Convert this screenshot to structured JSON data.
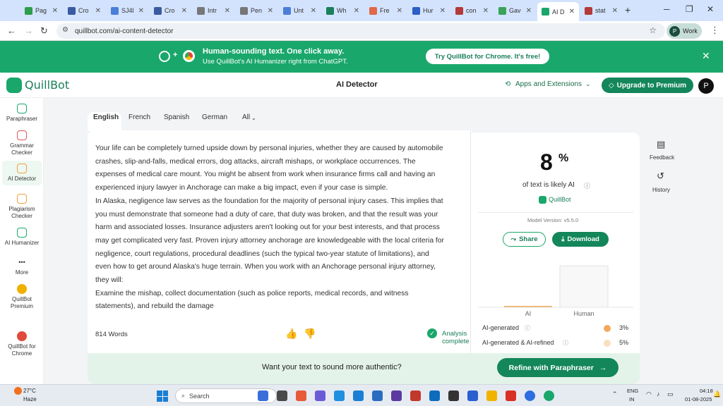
{
  "browser": {
    "tabs": [
      {
        "label": "Pag",
        "color": "#2e9e4d"
      },
      {
        "label": "Cro",
        "color": "#3a5ba0"
      },
      {
        "label": "SJ4l",
        "color": "#4a7fd9"
      },
      {
        "label": "Cro",
        "color": "#3a5ba0"
      },
      {
        "label": "Intr",
        "color": "#777777"
      },
      {
        "label": "Pen",
        "color": "#777777"
      },
      {
        "label": "Unt",
        "color": "#4a7fd9"
      },
      {
        "label": "Wh",
        "color": "#1a7f5a"
      },
      {
        "label": "Fre",
        "color": "#e06848"
      },
      {
        "label": "Hur",
        "color": "#2d5fc4"
      },
      {
        "label": "con",
        "color": "#b33a3a"
      },
      {
        "label": "Gav",
        "color": "#3aa35a"
      },
      {
        "label": "AI D",
        "color": "#1aa76b"
      },
      {
        "label": "stat",
        "color": "#b33a3a"
      }
    ],
    "new_tab": "+",
    "url": "quillbot.com/ai-content-detector",
    "profile_label": "Work",
    "profile_initial": "P"
  },
  "banner": {
    "title": "Human-sounding text. One click away.",
    "subtitle": "Use QuillBot's AI Humanizer right from ChatGPT.",
    "cta": "Try QuillBot for Chrome. It's free!",
    "plus": "+"
  },
  "header": {
    "logo_text": "QuillBot",
    "page_title": "AI Detector",
    "apps_label": "Apps and Extensions",
    "upgrade_label": "Upgrade to Premium",
    "avatar_initial": "P"
  },
  "sidebar": {
    "items": [
      {
        "label": "Paraphraser",
        "color": "#1aa76b"
      },
      {
        "label": "Grammar Checker",
        "color": "#e05555"
      },
      {
        "label": "AI Detector",
        "color": "#f0a040"
      },
      {
        "label": "Plagiarism Checker",
        "color": "#f0a040"
      },
      {
        "label": "AI Humanizer",
        "color": "#1aa76b"
      },
      {
        "label": "More",
        "color": "#333333"
      },
      {
        "label": "QuillBot Premium",
        "color": "#f0b000"
      },
      {
        "label": "QuillBot for Chrome",
        "color": "#e04a3a"
      }
    ]
  },
  "editor": {
    "languages": [
      "English",
      "French",
      "Spanish",
      "German",
      "All"
    ],
    "paragraphs": [
      "Your life can be completely turned upside down by personal injuries, whether they are caused by automobile crashes, slip-and-falls, medical errors, dog attacks, aircraft mishaps, or workplace occurrences. The expenses of medical care mount. You might be absent from work when insurance firms call and having an experienced injury lawyer in Anchorage can make a big impact, even if your case is simple.",
      "In Alaska, negligence law serves as the foundation for the majority of personal injury cases. This implies that you must demonstrate that someone had a duty of care, that duty was broken, and that the result was your harm and associated losses. Insurance adjusters aren't looking out for your best interests, and that process may get complicated very fast. Proven injury attorney anchorage are knowledgeable with the local criteria for negligence, court regulations, procedural deadlines (such the typical two-year statute of limitations), and even how to get around Alaska's huge terrain. When you work with an Anchorage personal injury attorney, they will:",
      "Examine the mishap, collect documentation (such as police reports, medical records, and witness statements), and rebuild the damage"
    ],
    "word_count": "814 Words",
    "status": "Analysis complete"
  },
  "results": {
    "percent": "8",
    "percent_sign": "%",
    "caption": "of text is likely AI",
    "brand": "QuillBot",
    "model_version": "Model Version: v5.5.0",
    "share_label": "Share",
    "download_label": "Download",
    "chart_data": {
      "type": "bar",
      "categories": [
        "AI",
        "Human"
      ],
      "values": [
        3,
        92
      ],
      "colors": [
        "#f2a95c",
        "#f8f8f8"
      ]
    },
    "breakdown": [
      {
        "label": "AI-generated",
        "value": "3%",
        "color": "#f2a95c"
      },
      {
        "label": "AI-generated & AI-refined",
        "value": "5%",
        "color": "#fadfbf"
      }
    ]
  },
  "right_rail": {
    "feedback": "Feedback",
    "history": "History"
  },
  "promo": {
    "text": "Want your text to sound more authentic?",
    "button": "Refine with Paraphraser"
  },
  "taskbar": {
    "temperature": "27°C",
    "weather": "Haze",
    "search_placeholder": "Search",
    "lang": "ENG",
    "region": "IN",
    "time": "04:18",
    "date": "01-08-2025"
  }
}
